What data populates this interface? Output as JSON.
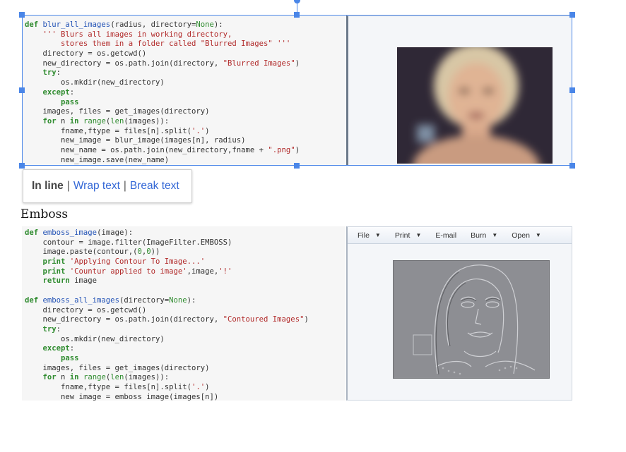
{
  "wrap_popup": {
    "inline": "In line",
    "wrap": "Wrap text",
    "break": "Break text",
    "separator": "|"
  },
  "section_heading": "Emboss",
  "image_toolbar": {
    "items": [
      "File",
      "Print",
      "E-mail",
      "Burn",
      "Open"
    ]
  },
  "code_block_1": [
    [
      [
        "kw",
        "def "
      ],
      [
        "fn",
        "blur_all_images"
      ],
      [
        "t",
        "(radius, directory="
      ],
      [
        "nm",
        "None"
      ],
      [
        "t",
        "):"
      ]
    ],
    [
      [
        "t",
        "    "
      ],
      [
        "cm",
        "''' Blurs all images in working directory,"
      ]
    ],
    [
      [
        "cm",
        "        stores them in a folder called \"Blurred Images\" '''"
      ]
    ],
    [
      [
        "t",
        "    directory = os.getcwd()"
      ]
    ],
    [
      [
        "t",
        "    new_directory = os.path.join(directory, "
      ],
      [
        "st",
        "\"Blurred Images\""
      ],
      [
        "t",
        ")"
      ]
    ],
    [
      [
        "t",
        "    "
      ],
      [
        "kw",
        "try"
      ],
      [
        "t",
        ":"
      ]
    ],
    [
      [
        "t",
        "        os.mkdir(new_directory)"
      ]
    ],
    [
      [
        "t",
        "    "
      ],
      [
        "kw",
        "except"
      ],
      [
        "t",
        ":"
      ]
    ],
    [
      [
        "t",
        "        "
      ],
      [
        "kw",
        "pass"
      ]
    ],
    [
      [
        "t",
        "    images, files = get_images(directory)"
      ]
    ],
    [
      [
        "t",
        "    "
      ],
      [
        "kw",
        "for"
      ],
      [
        "t",
        " n "
      ],
      [
        "kw",
        "in"
      ],
      [
        "t",
        " "
      ],
      [
        "bi",
        "range"
      ],
      [
        "t",
        "("
      ],
      [
        "bi",
        "len"
      ],
      [
        "t",
        "(images)):"
      ]
    ],
    [
      [
        "t",
        "        fname,ftype = files[n].split("
      ],
      [
        "st",
        "'.'"
      ],
      [
        "t",
        ")"
      ]
    ],
    [
      [
        "t",
        "        new_image = blur_image(images[n], radius)"
      ]
    ],
    [
      [
        "t",
        "        new_name = os.path.join(new_directory,fname + "
      ],
      [
        "st",
        "\".png\""
      ],
      [
        "t",
        ")"
      ]
    ],
    [
      [
        "t",
        "        new_image.save(new_name)"
      ]
    ]
  ],
  "code_block_2": [
    [
      [
        "kw",
        "def "
      ],
      [
        "fn",
        "emboss_image"
      ],
      [
        "t",
        "(image):"
      ]
    ],
    [
      [
        "t",
        "    contour = image.filter(ImageFilter.EMBOSS)"
      ]
    ],
    [
      [
        "t",
        "    image.paste(contour,("
      ],
      [
        "nm",
        "0"
      ],
      [
        "t",
        ","
      ],
      [
        "nm",
        "0"
      ],
      [
        "t",
        "))"
      ]
    ],
    [
      [
        "t",
        "    "
      ],
      [
        "kw",
        "print"
      ],
      [
        "t",
        " "
      ],
      [
        "st",
        "'Applying Contour To Image...'"
      ]
    ],
    [
      [
        "t",
        "    "
      ],
      [
        "kw",
        "print"
      ],
      [
        "t",
        " "
      ],
      [
        "st",
        "'Countur applied to image'"
      ],
      [
        "t",
        ",image,"
      ],
      [
        "st",
        "'!'"
      ]
    ],
    [
      [
        "t",
        "    "
      ],
      [
        "kw",
        "return"
      ],
      [
        "t",
        " image"
      ]
    ],
    [
      [
        "t",
        ""
      ]
    ],
    [
      [
        "kw",
        "def "
      ],
      [
        "fn",
        "emboss_all_images"
      ],
      [
        "t",
        "(directory="
      ],
      [
        "nm",
        "None"
      ],
      [
        "t",
        "):"
      ]
    ],
    [
      [
        "t",
        "    directory = os.getcwd()"
      ]
    ],
    [
      [
        "t",
        "    new_directory = os.path.join(directory, "
      ],
      [
        "st",
        "\"Contoured Images\""
      ],
      [
        "t",
        ")"
      ]
    ],
    [
      [
        "t",
        "    "
      ],
      [
        "kw",
        "try"
      ],
      [
        "t",
        ":"
      ]
    ],
    [
      [
        "t",
        "        os.mkdir(new_directory)"
      ]
    ],
    [
      [
        "t",
        "    "
      ],
      [
        "kw",
        "except"
      ],
      [
        "t",
        ":"
      ]
    ],
    [
      [
        "t",
        "        "
      ],
      [
        "kw",
        "pass"
      ]
    ],
    [
      [
        "t",
        "    images, files = get_images(directory)"
      ]
    ],
    [
      [
        "t",
        "    "
      ],
      [
        "kw",
        "for"
      ],
      [
        "t",
        " n "
      ],
      [
        "kw",
        "in"
      ],
      [
        "t",
        " "
      ],
      [
        "bi",
        "range"
      ],
      [
        "t",
        "("
      ],
      [
        "bi",
        "len"
      ],
      [
        "t",
        "(images)):"
      ]
    ],
    [
      [
        "t",
        "        fname,ftype = files[n].split("
      ],
      [
        "st",
        "'.'"
      ],
      [
        "t",
        ")"
      ]
    ],
    [
      [
        "t",
        "        new_image = emboss_image(images[n])"
      ]
    ]
  ],
  "colors": {
    "keyword": "#2e8b2e",
    "function_name": "#2151b5",
    "string": "#b12a2a",
    "selection": "#4a86e8",
    "link": "#3367d6"
  }
}
